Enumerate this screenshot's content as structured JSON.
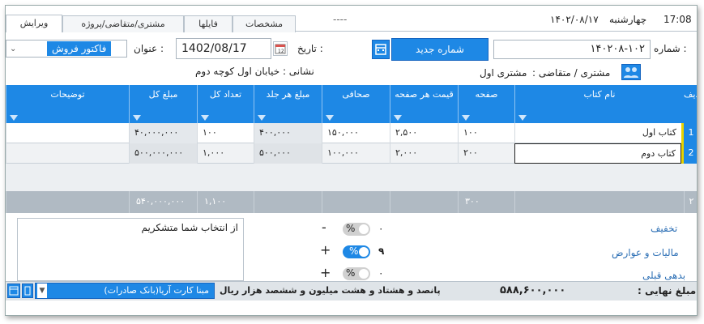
{
  "tabs": [
    "ویرایش",
    "مشتری/متقاضی/پروژه",
    "فایلها",
    "مشخصات"
  ],
  "status_top": {
    "time": "17:08",
    "day": "چهارشنبه",
    "date": "۱۴۰۲/۰۸/۱۷"
  },
  "dash_mark": "----",
  "form": {
    "number_label": "شماره :",
    "number_value": "۱۴۰۲۰۸-۱۰۲",
    "new_number_button": "شماره جدید",
    "date_label": "تاریخ :",
    "date_value": "1402/08/17",
    "title_label": "عنوان :",
    "title_value": "فاکتور فروش",
    "customer_label": "مشتری / متقاضی :",
    "customer_value": "مشتری اول",
    "address": "نشانی : خیابان اول کوچه دوم"
  },
  "grid": {
    "columns": [
      "ردیف",
      "نام کتاب",
      "صفحه",
      "قیمت هر صفحه",
      "صحافی",
      "مبلغ هر جلد",
      "تعداد کل",
      "مبلغ کل",
      "توضیحات"
    ],
    "rows": [
      {
        "num": "1",
        "name": "کتاب اول",
        "pages": "۱۰۰",
        "price_page": "۲,۵۰۰",
        "binding": "۱۵۰,۰۰۰",
        "unit": "۴۰۰,۰۰۰",
        "count": "۱۰۰",
        "total": "۴۰,۰۰۰,۰۰۰",
        "desc": ""
      },
      {
        "num": "2",
        "name": "کتاب دوم",
        "pages": "۲۰۰",
        "price_page": "۲,۰۰۰",
        "binding": "۱۰۰,۰۰۰",
        "unit": "۵۰۰,۰۰۰",
        "count": "۱,۰۰۰",
        "total": "۵۰۰,۰۰۰,۰۰۰",
        "desc": ""
      }
    ],
    "footer": {
      "count": "۲",
      "pages": "۳۰۰",
      "total_count": "۱,۱۰۰",
      "total": "۵۴۰,۰۰۰,۰۰۰"
    }
  },
  "notes": "از انتخاب شما متشکریم",
  "adjustments": [
    {
      "label": "تخفیف",
      "sign": "-",
      "pct": "%",
      "on": false,
      "value": "۰"
    },
    {
      "label": "مالیات و عوارض",
      "sign": "+",
      "pct": "%",
      "on": true,
      "value": "۹"
    },
    {
      "label": "بدهی قبلی",
      "sign": "+",
      "pct": "%",
      "on": false,
      "value": "۰"
    }
  ],
  "final": {
    "label": "مبلغ نهایی :",
    "value": "۵۸۸,۶۰۰,۰۰۰",
    "words": "پانصد و هشتاد و هشت میلیون و ششصد هزار ریال",
    "bank": "مبنا کارت آریا(بانک صادرات)"
  },
  "colors": {
    "accent": "#1e88e5",
    "footer": "#b0bac3"
  }
}
